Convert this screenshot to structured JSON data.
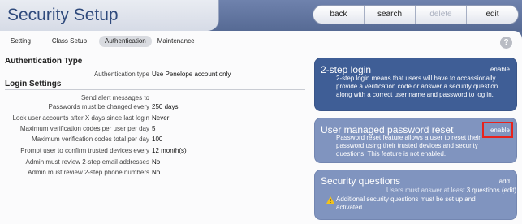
{
  "header": {
    "title": "Security Setup",
    "buttons": [
      {
        "label": "back"
      },
      {
        "label": "search"
      },
      {
        "label": "delete"
      },
      {
        "label": "edit"
      }
    ]
  },
  "tabs": [
    {
      "label": "Setting"
    },
    {
      "label": "Class Setup"
    },
    {
      "label": "Authentication"
    },
    {
      "label": "Maintenance"
    }
  ],
  "active_tab": "Authentication",
  "authentication_type": {
    "heading": "Authentication Type",
    "label": "Authentication type",
    "value": "Use Penelope account only"
  },
  "login_settings": {
    "heading": "Login Settings",
    "rows": [
      {
        "label": "Send alert messages to",
        "value": ""
      },
      {
        "label": "Passwords must be changed every",
        "value": "250 days"
      },
      {
        "label": "Lock user accounts after X days since last login",
        "value": "Never"
      },
      {
        "label": "Maximum verification codes per user per day",
        "value": "5"
      },
      {
        "label": "Maximum verification codes total per day",
        "value": "100"
      },
      {
        "label": "Prompt user to confirm trusted devices every",
        "value": "12 month(s)"
      },
      {
        "label": "Admin must review 2-step email addresses",
        "value": "No"
      },
      {
        "label": "Admin must review 2-step phone numbers",
        "value": "No"
      }
    ]
  },
  "cards": {
    "two_step": {
      "title": "2-step login",
      "action": "enable",
      "description": "2-step login means that users will have to occassionally provide a verification code or answer a security question along with a correct user name and password to log in."
    },
    "password_reset": {
      "title": "User managed password reset",
      "action": "enable",
      "description": "Password reset feature allows a user to reset their password using their trusted devices and security questions. This feature is not enabled."
    },
    "security_questions": {
      "title": "Security questions",
      "action": "add",
      "line": "Users must answer at least",
      "count": "3 questions (edit)",
      "warning": "Additional security questions must be set up and activated."
    }
  },
  "colors": {
    "header_bg": "#5b6e97",
    "title_text": "#2f4a7c",
    "card_dark": "#3f5e96",
    "card_light": "#8094bf",
    "highlight": "#e8231d"
  },
  "icons": {
    "help": "question-mark",
    "warning": "warning-triangle"
  }
}
